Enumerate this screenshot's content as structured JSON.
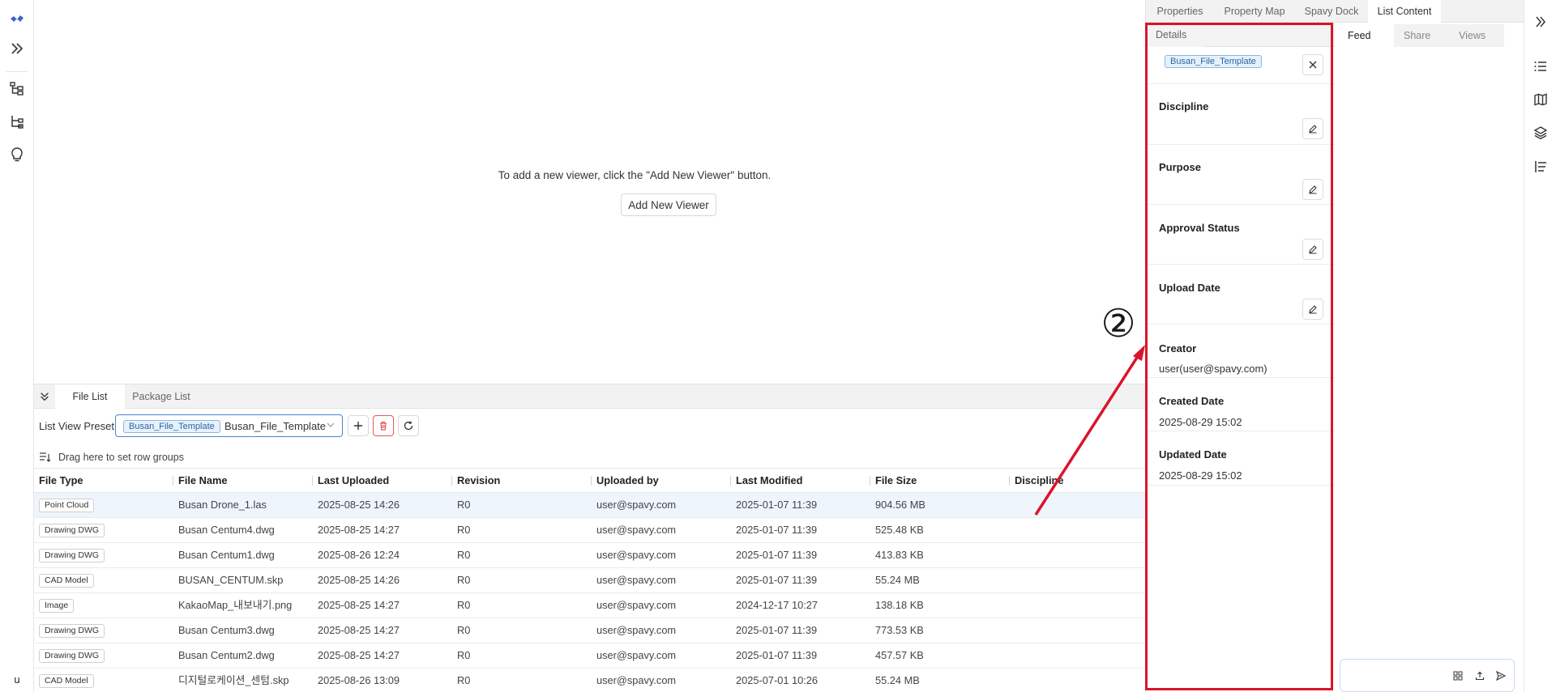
{
  "left_rail": {
    "user_initial": "u",
    "icons": [
      "logo-icon",
      "expand-icon",
      "tree-view-icon",
      "hierarchy-icon",
      "lightbulb-icon"
    ]
  },
  "viewer": {
    "empty_message": "To add a new viewer, click the \"Add New Viewer\" button.",
    "add_button": "Add New Viewer"
  },
  "bottom_panel": {
    "tabs": [
      "File List",
      "Package List"
    ],
    "active_tab": "File List",
    "preset_label": "List View Preset",
    "preset_chip": "Busan_File_Template",
    "preset_value": "Busan_File_Template",
    "group_hint": "Drag here to set row groups",
    "columns": [
      "File Type",
      "File Name",
      "Last Uploaded",
      "Revision",
      "Uploaded by",
      "Last Modified",
      "File Size",
      "Discipline"
    ],
    "rows": [
      {
        "type": "Point Cloud",
        "name": "Busan Drone_1.las",
        "uploaded": "2025-08-25 14:26",
        "revision": "R0",
        "by": "user@spavy.com",
        "modified": "2025-01-07 11:39",
        "size": "904.56 MB",
        "discipline": "",
        "selected": true
      },
      {
        "type": "Drawing DWG",
        "name": "Busan Centum4.dwg",
        "uploaded": "2025-08-25 14:27",
        "revision": "R0",
        "by": "user@spavy.com",
        "modified": "2025-01-07 11:39",
        "size": "525.48 KB",
        "discipline": ""
      },
      {
        "type": "Drawing DWG",
        "name": "Busan Centum1.dwg",
        "uploaded": "2025-08-26 12:24",
        "revision": "R0",
        "by": "user@spavy.com",
        "modified": "2025-01-07 11:39",
        "size": "413.83 KB",
        "discipline": ""
      },
      {
        "type": "CAD Model",
        "name": "BUSAN_CENTUM.skp",
        "uploaded": "2025-08-25 14:26",
        "revision": "R0",
        "by": "user@spavy.com",
        "modified": "2025-01-07 11:39",
        "size": "55.24 MB",
        "discipline": ""
      },
      {
        "type": "Image",
        "name": "KakaoMap_내보내기.png",
        "uploaded": "2025-08-25 14:27",
        "revision": "R0",
        "by": "user@spavy.com",
        "modified": "2024-12-17 10:27",
        "size": "138.18 KB",
        "discipline": ""
      },
      {
        "type": "Drawing DWG",
        "name": "Busan Centum3.dwg",
        "uploaded": "2025-08-25 14:27",
        "revision": "R0",
        "by": "user@spavy.com",
        "modified": "2025-01-07 11:39",
        "size": "773.53 KB",
        "discipline": ""
      },
      {
        "type": "Drawing DWG",
        "name": "Busan Centum2.dwg",
        "uploaded": "2025-08-25 14:27",
        "revision": "R0",
        "by": "user@spavy.com",
        "modified": "2025-01-07 11:39",
        "size": "457.57 KB",
        "discipline": ""
      },
      {
        "type": "CAD Model",
        "name": "디지털로케이션_센텀.skp",
        "uploaded": "2025-08-26 13:09",
        "revision": "R0",
        "by": "user@spavy.com",
        "modified": "2025-07-01 10:26",
        "size": "55.24 MB",
        "discipline": ""
      }
    ]
  },
  "right_panel": {
    "top_tabs": [
      "Properties",
      "Property Map",
      "Spavy Dock",
      "List Content"
    ],
    "active_top_tab": "List Content",
    "details_tab": "Details",
    "template_chip": "Busan_File_Template",
    "fields": [
      {
        "label": "Discipline",
        "value": "",
        "editable": true
      },
      {
        "label": "Purpose",
        "value": "",
        "editable": true
      },
      {
        "label": "Approval Status",
        "value": "",
        "editable": true
      },
      {
        "label": "Upload Date",
        "value": "",
        "editable": true
      },
      {
        "label": "Creator",
        "value": "user(user@spavy.com)",
        "editable": false
      },
      {
        "label": "Created Date",
        "value": "2025-08-29 15:02",
        "editable": false
      },
      {
        "label": "Updated Date",
        "value": "2025-08-29 15:02",
        "editable": false
      }
    ],
    "feed_tabs": [
      "Feed",
      "Share",
      "Views"
    ],
    "active_feed_tab": "Feed"
  },
  "annotation": {
    "label": "②",
    "color": "#d9142b"
  }
}
